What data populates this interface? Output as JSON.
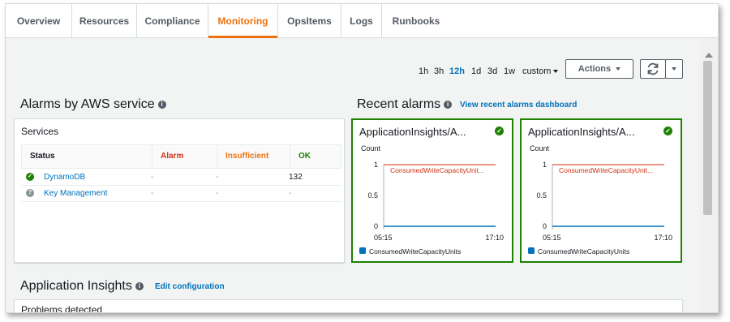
{
  "tabs": [
    {
      "label": "Overview",
      "active": false
    },
    {
      "label": "Resources",
      "active": false
    },
    {
      "label": "Compliance",
      "active": false
    },
    {
      "label": "Monitoring",
      "active": true
    },
    {
      "label": "OpsItems",
      "active": false
    },
    {
      "label": "Logs",
      "active": false
    },
    {
      "label": "Runbooks",
      "active": false
    }
  ],
  "time_range": {
    "options": [
      "1h",
      "3h",
      "12h",
      "1d",
      "3d",
      "1w"
    ],
    "selected": "12h",
    "custom_label": "custom"
  },
  "toolbar": {
    "actions_label": "Actions"
  },
  "alarms_by_service": {
    "heading": "Alarms by AWS service",
    "panel_title": "Services",
    "columns": {
      "status": "Status",
      "alarm": "Alarm",
      "insufficient": "Insufficient",
      "ok": "OK"
    },
    "rows": [
      {
        "service": "DynamoDB",
        "status": "ok",
        "alarm": "-",
        "insufficient": "-",
        "ok": "132"
      },
      {
        "service": "Key Management",
        "status": "unknown",
        "alarm": "-",
        "insufficient": "-",
        "ok": "-"
      }
    ]
  },
  "recent_alarms": {
    "heading": "Recent alarms",
    "link": "View recent alarms dashboard",
    "cards": [
      {
        "title": "ApplicationInsights/A...",
        "status": "ok"
      },
      {
        "title": "ApplicationInsights/A...",
        "status": "ok"
      }
    ]
  },
  "chart_data": [
    {
      "type": "line",
      "ylabel": "Count",
      "yticks": [
        "1",
        "0.5",
        "0"
      ],
      "ylim": [
        0,
        1
      ],
      "xticks": [
        "05:15",
        "17:10"
      ],
      "threshold": {
        "value": 1,
        "label": "ConsumedWriteCapacityUnit..."
      },
      "series": [
        {
          "name": "ConsumedWriteCapacityUnits",
          "values": [
            0,
            0
          ]
        }
      ],
      "legend": "bottom"
    },
    {
      "type": "line",
      "ylabel": "Count",
      "yticks": [
        "1",
        "0.5",
        "0"
      ],
      "ylim": [
        0,
        1
      ],
      "xticks": [
        "05:15",
        "17:10"
      ],
      "threshold": {
        "value": 1,
        "label": "ConsumedWriteCapacityUnit..."
      },
      "series": [
        {
          "name": "ConsumedWriteCapacityUnits",
          "values": [
            0,
            0
          ]
        }
      ],
      "legend": "bottom"
    }
  ],
  "application_insights": {
    "heading": "Application Insights",
    "link": "Edit configuration",
    "panel_title": "Problems detected"
  },
  "colors": {
    "accent": "#ec7211",
    "link": "#0073bb",
    "ok": "#1d8102",
    "alarm": "#d13212",
    "insufficient": "#ec7211",
    "series": "#0073bb"
  }
}
